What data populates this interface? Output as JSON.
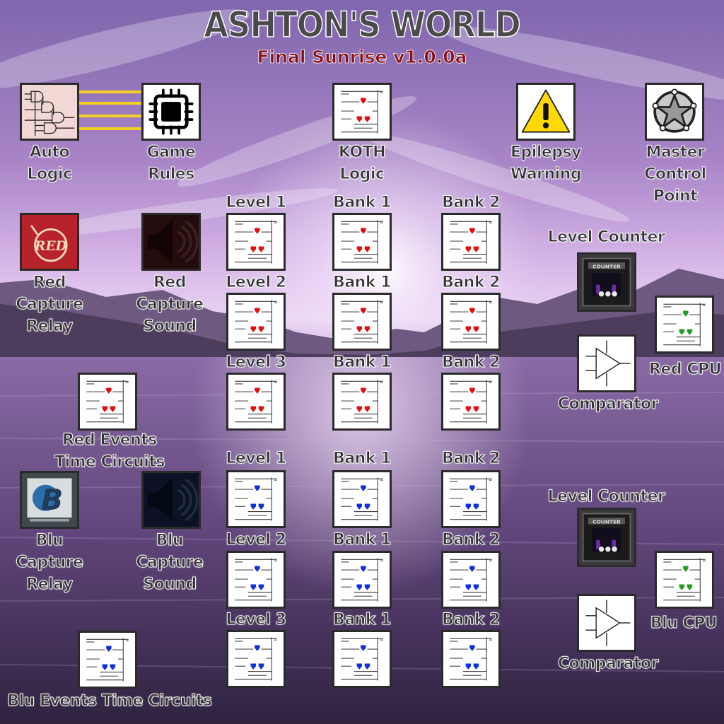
{
  "header": {
    "title": "ASHTON'S WORLD",
    "subtitle": "Final Sunrise  v1.0.0a"
  },
  "colors": {
    "title": "#4a4a4a",
    "subtitle": "#8a0f14",
    "label_text": "#3a3a3a",
    "label_outline": "#ffffff",
    "wire_yellow": "#f4d020",
    "red_marker": "#e01010",
    "blu_marker": "#1030e0",
    "cpu_marker": "#20a020",
    "sky_top": "#8a6fb8",
    "sky_mid": "#cfa4df",
    "water": "#4b3563"
  },
  "top_row": {
    "auto_logic": {
      "label_line1": "Auto",
      "label_line2": "Logic",
      "icon": "logic-gates-icon"
    },
    "game_rules": {
      "label_line1": "Game",
      "label_line2": "Rules",
      "icon": "cpu-chip-icon"
    },
    "koth_logic": {
      "label_line1": "KOTH",
      "label_line2": "Logic",
      "icon": "circuit-schematic-icon"
    },
    "epilepsy_warning": {
      "label_line1": "Epilepsy",
      "label_line2": "Warning",
      "icon": "warning-triangle-icon"
    },
    "master_control_point": {
      "label_line1": "Master",
      "label_line2": "Control",
      "label_line3": "Point",
      "icon": "control-point-star-icon"
    }
  },
  "red_team": {
    "capture_relay": {
      "label_line1": "Red",
      "label_line2": "Capture",
      "label_line3": "Relay",
      "icon": "red-bomb-logo-icon"
    },
    "capture_sound": {
      "label_line1": "Red",
      "label_line2": "Capture",
      "label_line3": "Sound",
      "icon": "speaker-icon"
    },
    "events_time_circuits": {
      "label_line1": "Red Events",
      "label_line2": "Time Circuits"
    },
    "level_grid": [
      {
        "level": "Level 1",
        "bank1": "Bank 1",
        "bank2": "Bank 2"
      },
      {
        "level": "Level 2",
        "bank1": "Bank 1",
        "bank2": "Bank 2"
      },
      {
        "level": "Level 3",
        "bank1": "Bank 1",
        "bank2": "Bank 2"
      }
    ],
    "level_counter": "Level Counter",
    "comparator": "Comparator",
    "cpu": "Red CPU"
  },
  "blu_team": {
    "capture_relay": {
      "label_line1": "Blu",
      "label_line2": "Capture",
      "label_line3": "Relay",
      "icon": "blu-b-logo-icon"
    },
    "capture_sound": {
      "label_line1": "Blu",
      "label_line2": "Capture",
      "label_line3": "Sound",
      "icon": "speaker-icon"
    },
    "events_time_circuits": {
      "label": "Blu Events Time Circuits"
    },
    "level_grid": [
      {
        "level": "Level 1",
        "bank1": "Bank 1",
        "bank2": "Bank 2"
      },
      {
        "level": "Level 2",
        "bank1": "Bank 1",
        "bank2": "Bank 2"
      },
      {
        "level": "Level 3",
        "bank1": "Bank 1",
        "bank2": "Bank 2"
      }
    ],
    "level_counter": "Level Counter",
    "comparator": "Comparator",
    "cpu": "Blu CPU"
  },
  "counter_display_text": "COUNTER"
}
